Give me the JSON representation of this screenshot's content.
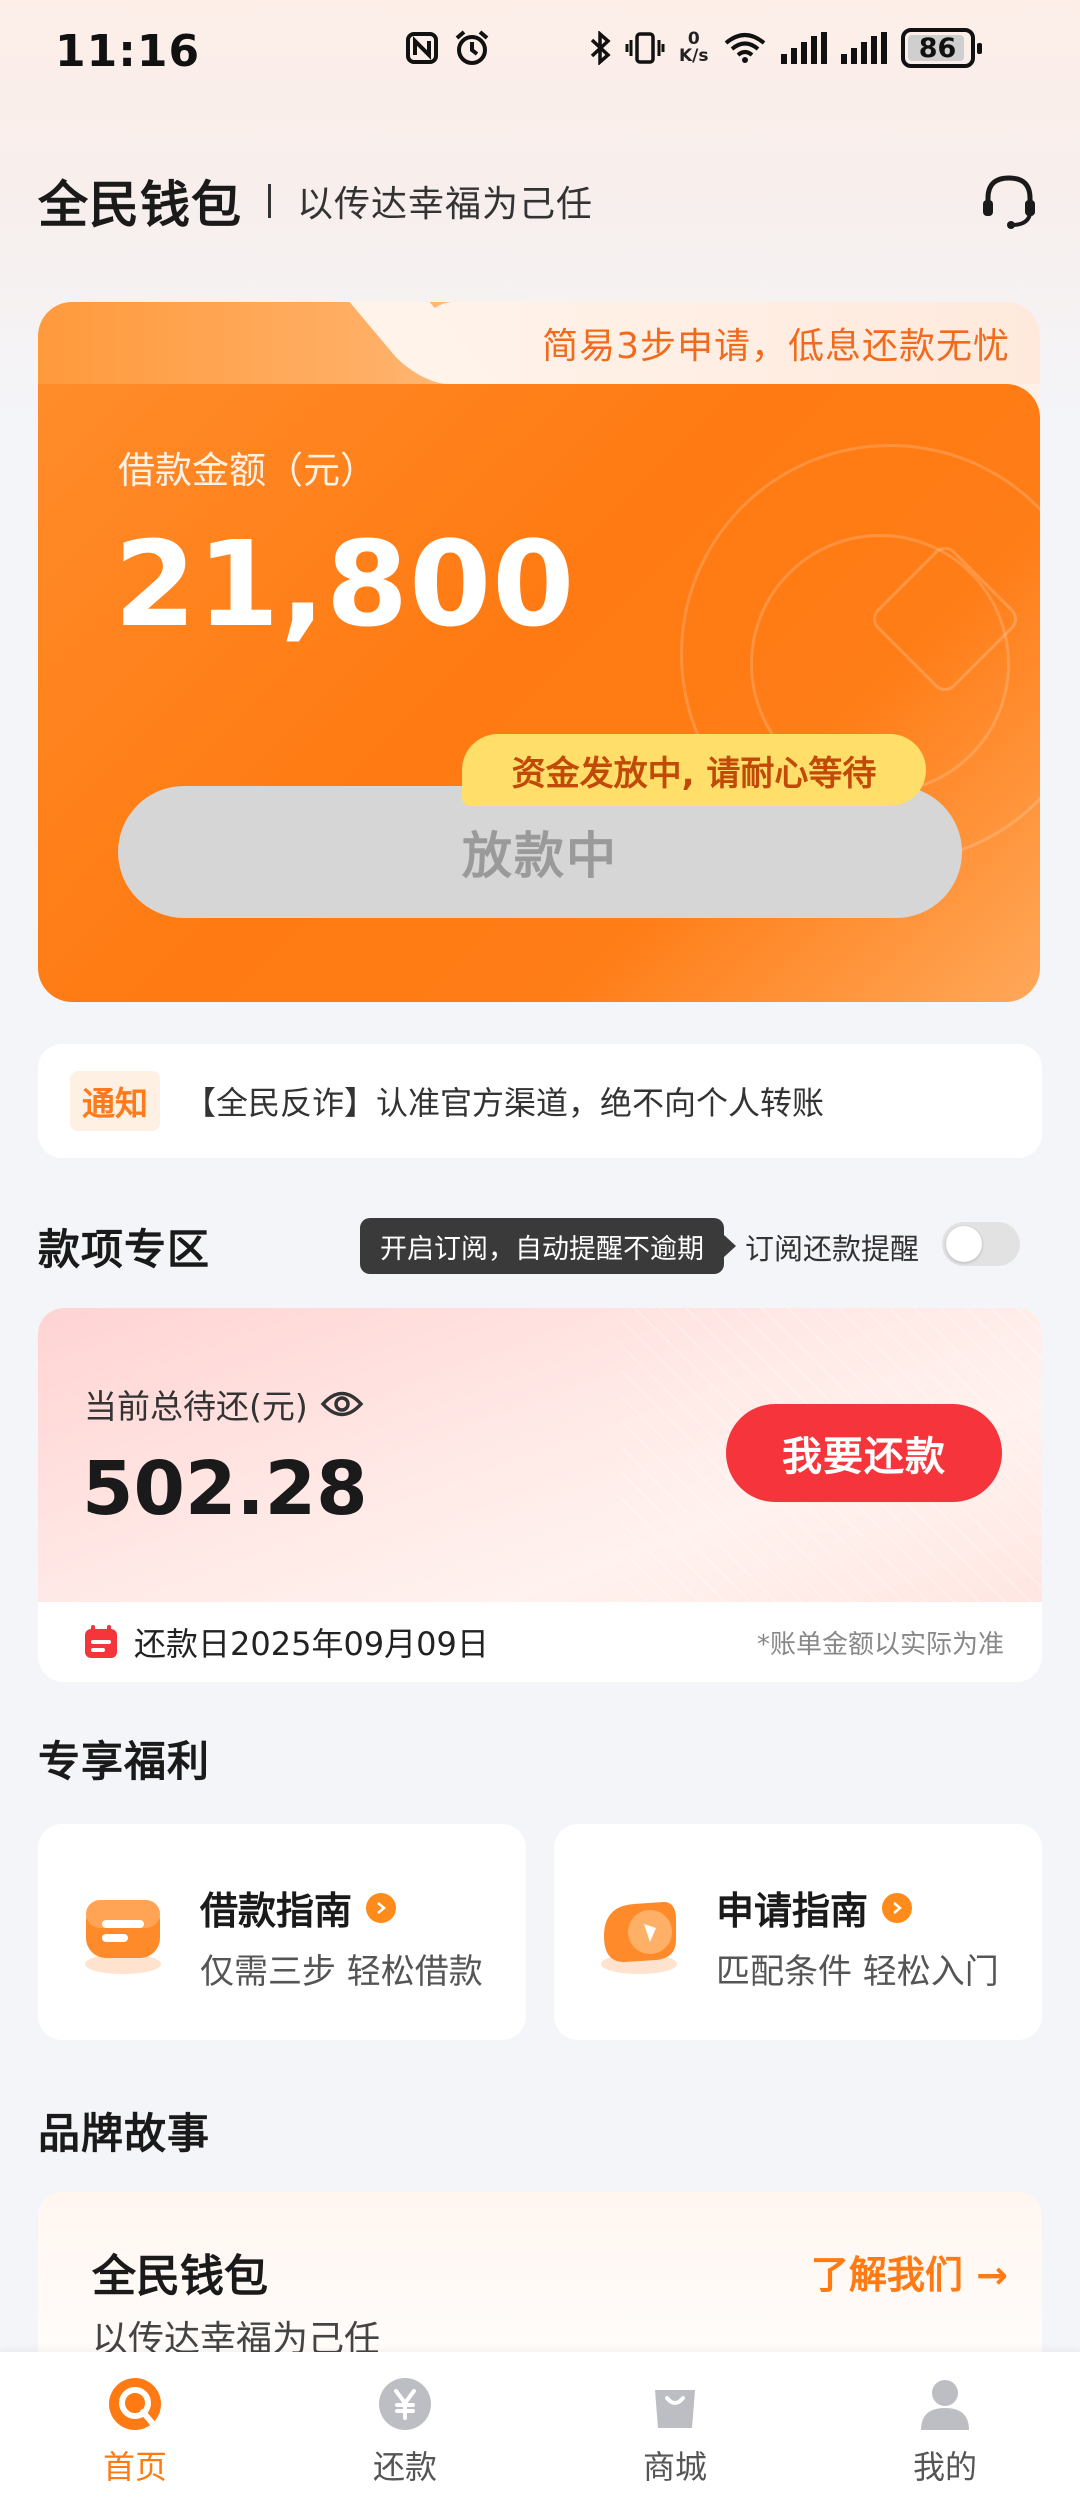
{
  "status_bar": {
    "time": "11:16",
    "speed_value": "0",
    "speed_unit": "K/s",
    "battery": "86"
  },
  "header": {
    "title": "全民钱包",
    "slogan": "以传达幸福为己任",
    "support_icon": "headset-icon"
  },
  "loan_card": {
    "tag": "简易3步申请，低息还款无忧",
    "label": "借款金额（元）",
    "amount": "21,800",
    "bubble": "资金发放中, 请耐心等待",
    "button": "放款中"
  },
  "notice": {
    "tag": "通知",
    "text": "【全民反诈】认准官方渠道，绝不向个人转账"
  },
  "payment_section": {
    "title": "款项专区",
    "tooltip": "开启订阅，自动提醒不逾期",
    "subscribe_label": "订阅还款提醒",
    "subscribe_on": false
  },
  "repay_card": {
    "label": "当前总待还(元)",
    "amount": "502.28",
    "button": "我要还款",
    "due_date": "还款日2025年09月09日",
    "note": "*账单金额以实际为准"
  },
  "benefits": {
    "title": "专享福利",
    "items": [
      {
        "title": "借款指南",
        "subtitle": "仅需三步 轻松借款",
        "icon": "loan-guide-icon"
      },
      {
        "title": "申请指南",
        "subtitle": "匹配条件 轻松入门",
        "icon": "apply-guide-icon"
      }
    ]
  },
  "brand_story": {
    "title": "品牌故事",
    "card_title": "全民钱包",
    "card_subtitle": "以传达幸福为己任",
    "link": "了解我们 →"
  },
  "tab_bar": {
    "items": [
      {
        "label": "首页",
        "active": true
      },
      {
        "label": "还款",
        "active": false
      },
      {
        "label": "商城",
        "active": false
      },
      {
        "label": "我的",
        "active": false
      }
    ]
  },
  "colors": {
    "accent": "#ff7a12",
    "repay_button": "#f5343c",
    "bubble": "#ffde6a"
  }
}
